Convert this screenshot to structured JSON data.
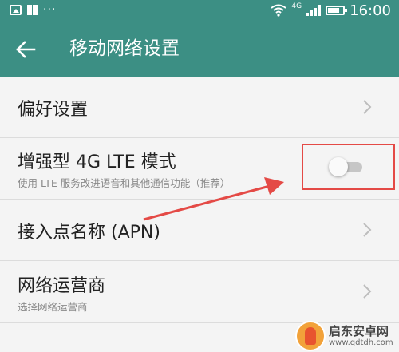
{
  "status_bar": {
    "network_type": "4G",
    "time": "16:00",
    "icons": [
      "image-icon",
      "grid-icon",
      "more-dots-icon",
      "wifi-icon",
      "signal-icon",
      "battery-icon"
    ]
  },
  "app_bar": {
    "back_icon": "back-arrow-icon",
    "title": "移动网络设置"
  },
  "settings": [
    {
      "title": "偏好设置",
      "subtitle": "",
      "control": "chevron"
    },
    {
      "title": "增强型 4G LTE 模式",
      "subtitle": "使用 LTE 服务改进语音和其他通信功能（推荐）",
      "control": "toggle",
      "toggle_on": false
    },
    {
      "title": "接入点名称 (APN)",
      "subtitle": "",
      "control": "chevron"
    },
    {
      "title": "网络运营商",
      "subtitle": "选择网络运营商",
      "control": "chevron"
    }
  ],
  "annotation": {
    "highlight_color": "#e44a46"
  },
  "watermark": {
    "name": "启东安卓网",
    "url": "www.qdtdh.com"
  },
  "colors": {
    "primary": "#3c8f84",
    "background": "#f4f4f4",
    "toggle_track_off": "#c6c6c6"
  }
}
